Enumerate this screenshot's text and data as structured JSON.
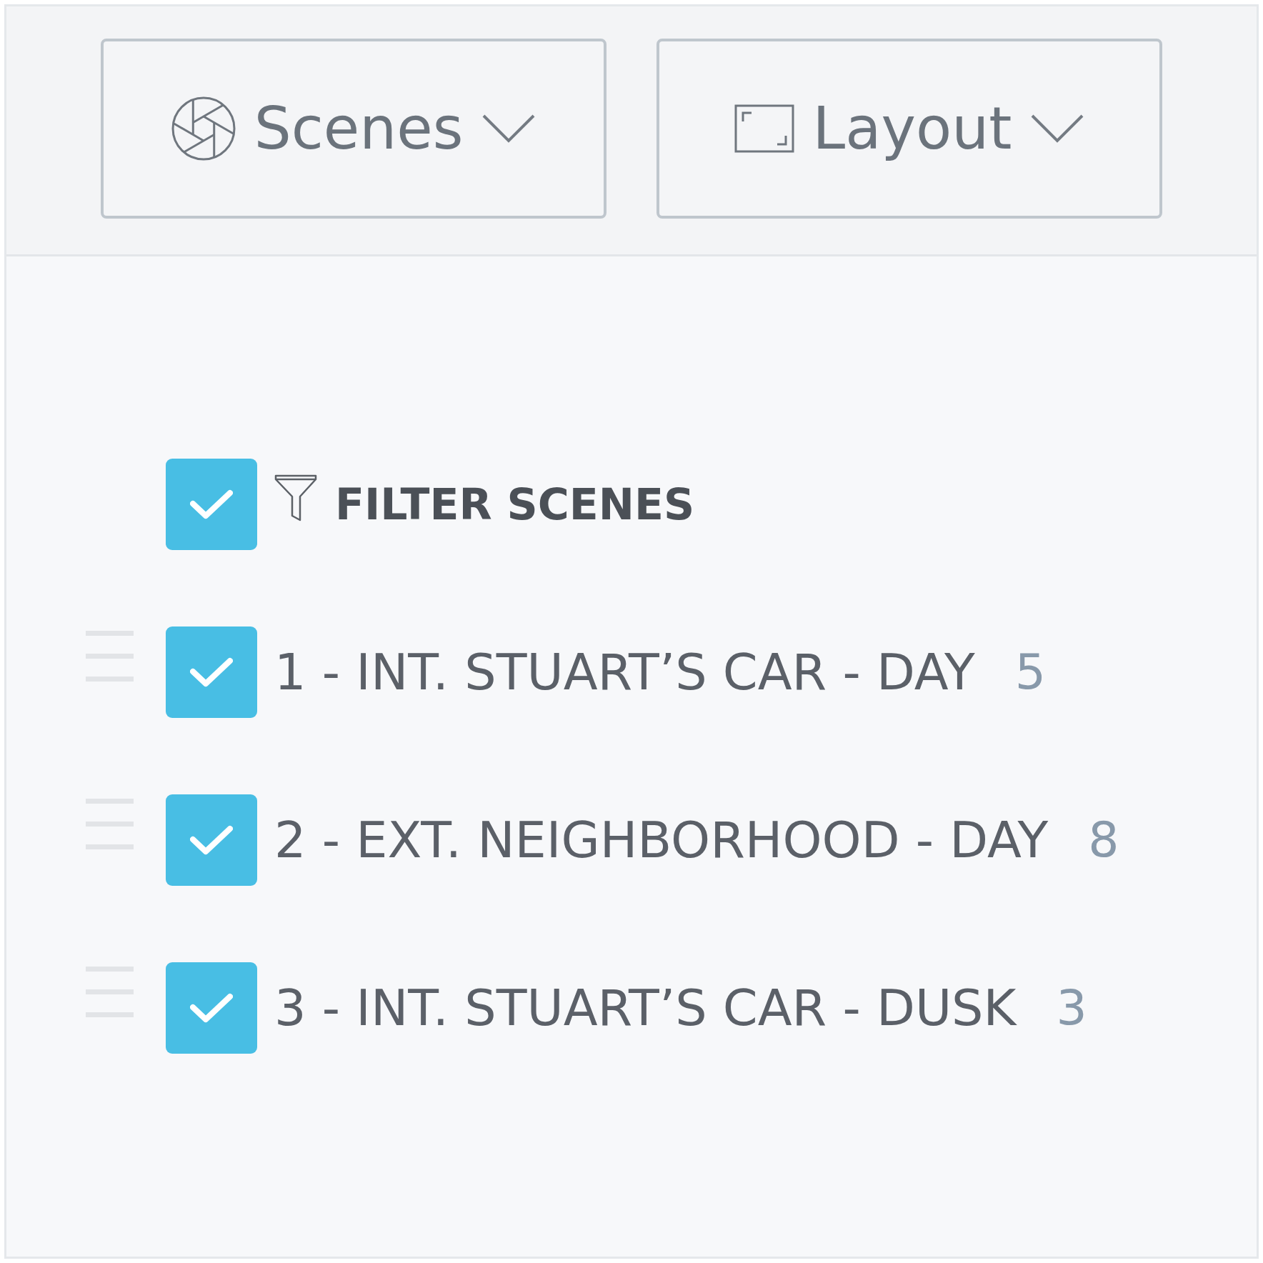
{
  "toolbar": {
    "buttons": [
      {
        "kind": "scenes",
        "label": "Scenes"
      },
      {
        "kind": "layout",
        "label": "Layout"
      }
    ]
  },
  "filter": {
    "label": "FILTER SCENES",
    "checked": true
  },
  "scenes": [
    {
      "label": "1 - INT. STUART’S CAR - DAY",
      "count": "5",
      "checked": true
    },
    {
      "label": "2 - EXT. NEIGHBORHOOD - DAY",
      "count": "8",
      "checked": true
    },
    {
      "label": "3 - INT. STUART’S CAR - DUSK",
      "count": "3",
      "checked": true
    }
  ]
}
